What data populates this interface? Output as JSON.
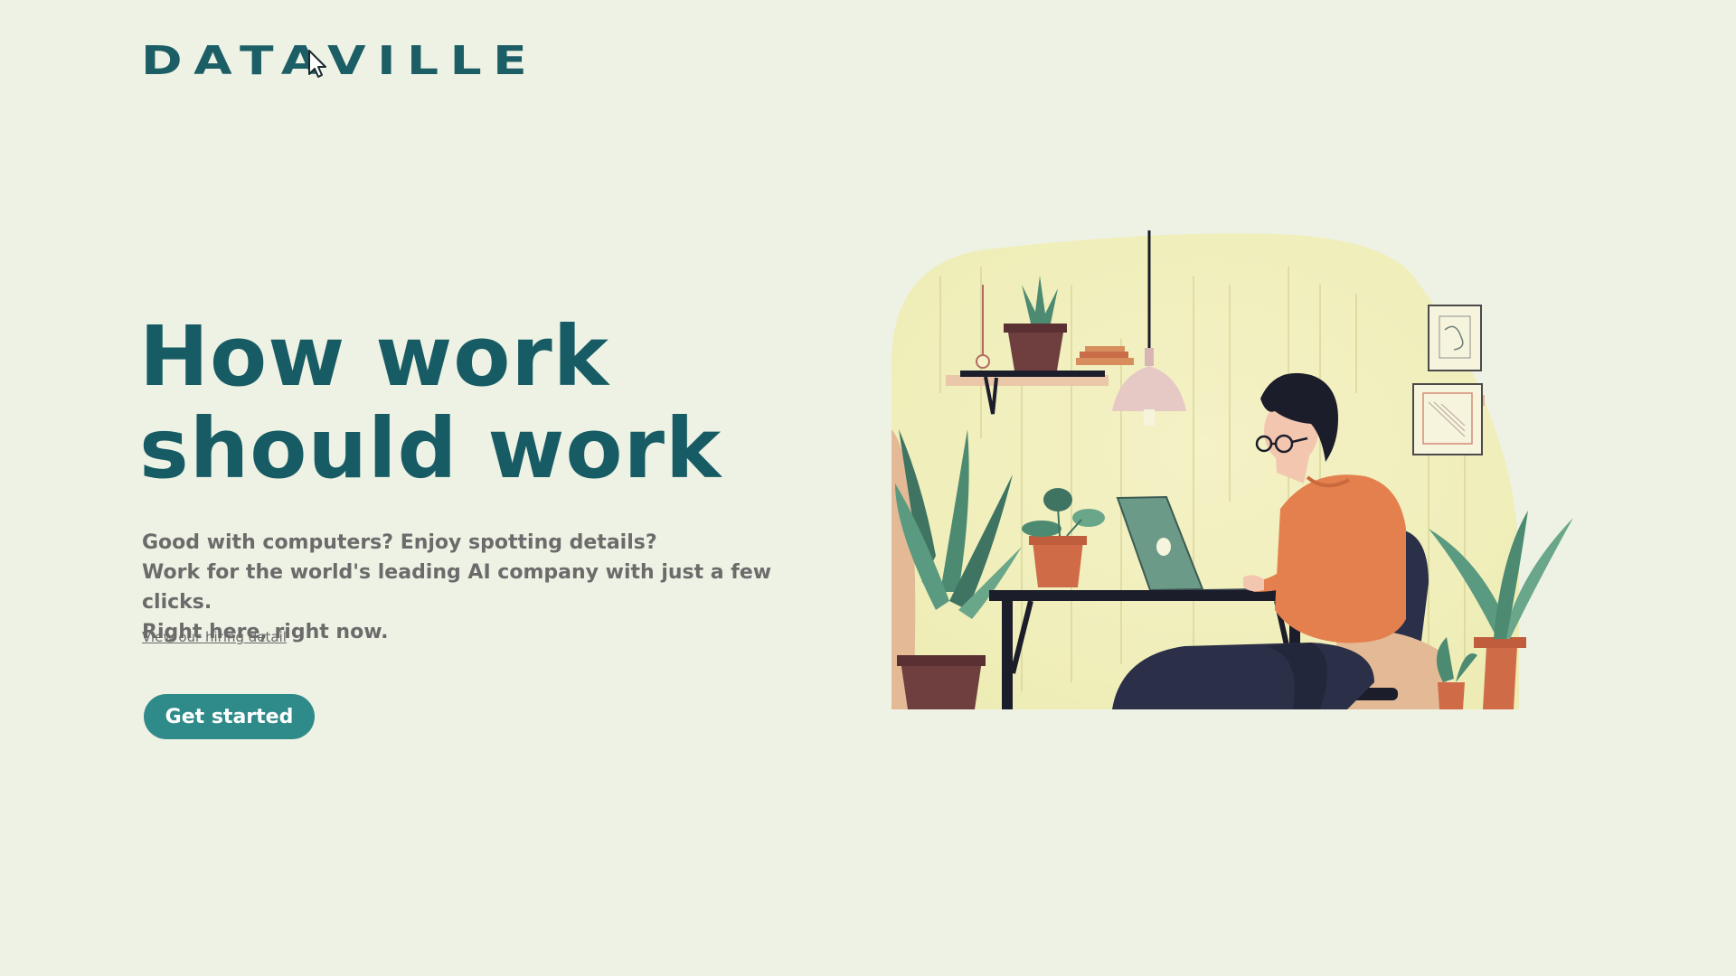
{
  "logo": {
    "text": "DATAVILLE",
    "icon": "cursor-arrow-icon"
  },
  "hero": {
    "headline_line1": "How work",
    "headline_line2": "should work",
    "subtitle_line1": "Good with computers? Enjoy spotting details?",
    "subtitle_line2": "Work for the world's leading AI company with just a few clicks.",
    "subtitle_line3": "Right here, right now.",
    "hiring_link": "View our hiring detail",
    "cta_label": "Get started"
  },
  "colors": {
    "background": "#eef2e4",
    "brand_teal": "#175c65",
    "cta_teal": "#2f8b8a",
    "muted_text": "#6b6b6b"
  },
  "illustration": {
    "subject": "person-working-on-laptop-illustration"
  }
}
